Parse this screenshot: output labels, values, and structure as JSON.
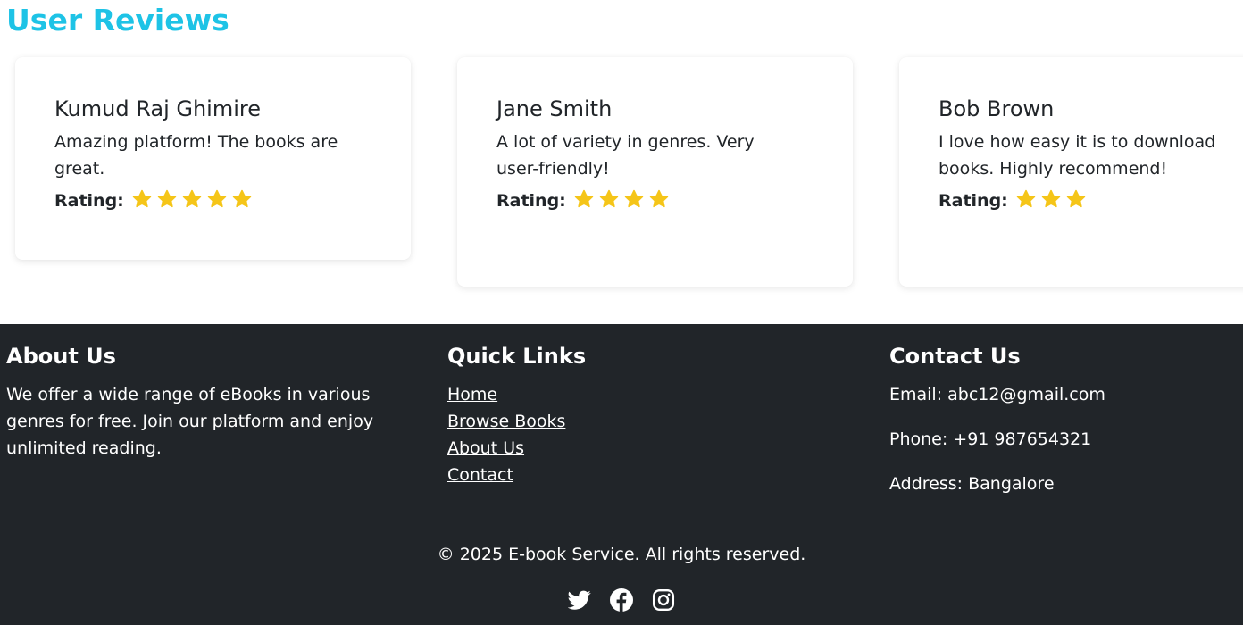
{
  "page": {
    "title": "User Reviews",
    "accent_color": "#1ec3e6",
    "star_color": "#f5c518"
  },
  "reviews": [
    {
      "name": "Kumud Raj Ghimire",
      "text": "Amazing platform! The books are great.",
      "rating_label": "Rating:",
      "stars": 5
    },
    {
      "name": "Jane Smith",
      "text": "A lot of variety in genres. Very user-friendly!",
      "rating_label": "Rating:",
      "stars": 4
    },
    {
      "name": "Bob Brown",
      "text": "I love how easy it is to download books. Highly recommend!",
      "rating_label": "Rating:",
      "stars": 3
    }
  ],
  "footer": {
    "background": "#212529",
    "about": {
      "heading": "About Us",
      "text": "We offer a wide range of eBooks in various genres for free. Join our platform and enjoy unlimited reading."
    },
    "quick_links": {
      "heading": "Quick Links",
      "links": [
        "Home",
        "Browse Books",
        "About Us",
        "Contact"
      ]
    },
    "contact": {
      "heading": "Contact Us",
      "email": "Email: abc12@gmail.com",
      "phone": "Phone: +91 987654321",
      "address": "Address: Bangalore"
    },
    "copyright": "© 2025 E-book Service. All rights reserved.",
    "social_icons": [
      "twitter-icon",
      "facebook-icon",
      "instagram-icon"
    ]
  }
}
